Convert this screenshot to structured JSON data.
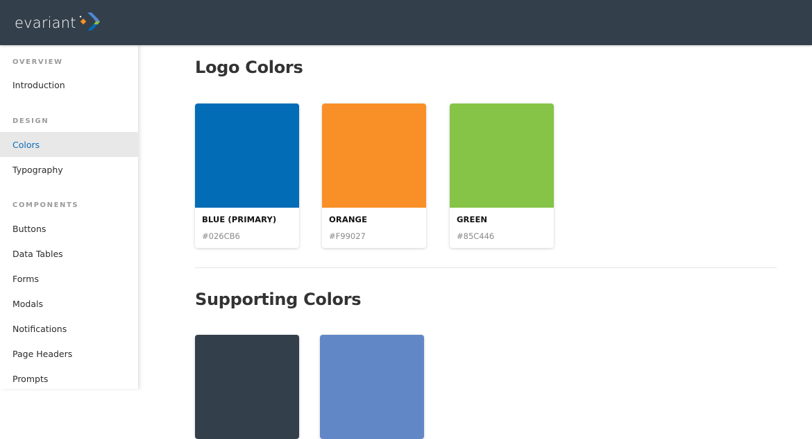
{
  "header": {
    "logo_text": "evariant",
    "logo_icon": "evariant-arrow-logo-icon",
    "background": "#333F4A"
  },
  "sidebar": {
    "sections": [
      {
        "label": "OVERVIEW",
        "items": [
          {
            "label": "Introduction",
            "active": false
          }
        ]
      },
      {
        "label": "DESIGN",
        "items": [
          {
            "label": "Colors",
            "active": true
          },
          {
            "label": "Typography",
            "active": false
          }
        ]
      },
      {
        "label": "COMPONENTS",
        "items": [
          {
            "label": "Buttons",
            "active": false
          },
          {
            "label": "Data Tables",
            "active": false
          },
          {
            "label": "Forms",
            "active": false
          },
          {
            "label": "Modals",
            "active": false
          },
          {
            "label": "Notifications",
            "active": false
          },
          {
            "label": "Page Headers",
            "active": false
          },
          {
            "label": "Prompts",
            "active": false
          }
        ]
      }
    ]
  },
  "main": {
    "logo_colors": {
      "title": "Logo Colors",
      "swatches": [
        {
          "name": "BLUE (PRIMARY)",
          "hex": "#026CB6",
          "color": "#026CB6"
        },
        {
          "name": "ORANGE",
          "hex": "#F99027",
          "color": "#F99027"
        },
        {
          "name": "GREEN",
          "hex": "#85C446",
          "color": "#85C446"
        }
      ]
    },
    "supporting_colors": {
      "title": "Supporting Colors",
      "swatches": [
        {
          "color": "#333F4A"
        },
        {
          "color": "#6287C6"
        }
      ]
    }
  }
}
